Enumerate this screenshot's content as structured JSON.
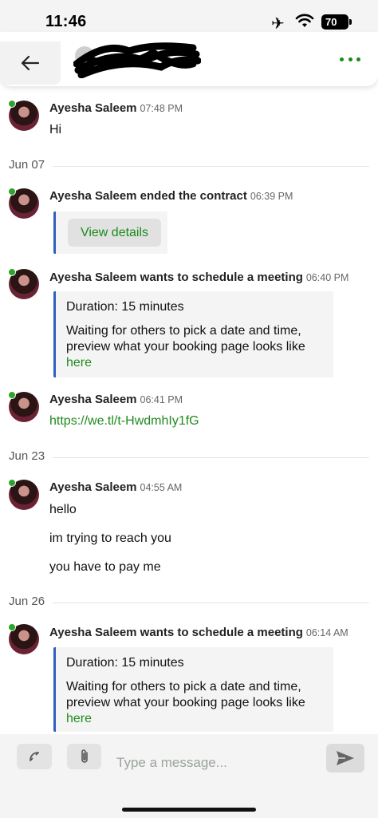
{
  "status_bar": {
    "time": "11:46",
    "battery": "70"
  },
  "header": {
    "contact_name": ""
  },
  "messages": [
    {
      "sender": "Ayesha Saleem",
      "time": "07:48 PM",
      "lines": [
        "Hi"
      ]
    }
  ],
  "date_jun07": "Jun 07",
  "msg_contract": {
    "sender": "Ayesha Saleem ended the contract",
    "time": "06:39 PM",
    "button": "View details"
  },
  "msg_meeting1": {
    "sender": "Ayesha Saleem wants to schedule a meeting",
    "time": "06:40 PM",
    "duration": "Duration: 15 minutes",
    "line1": "Waiting for others to pick a date and time,",
    "line2": "preview what your booking page looks like",
    "link": "here"
  },
  "msg_link": {
    "sender": "Ayesha Saleem",
    "time": "06:41 PM",
    "link": "https://we.tl/t-HwdmhIy1fG"
  },
  "date_jun23": "Jun 23",
  "msg_hello": {
    "sender": "Ayesha Saleem",
    "time": "04:55 AM",
    "lines": [
      "hello",
      "im trying to reach you",
      "you have to pay me"
    ]
  },
  "date_jun26": "Jun 26",
  "msg_meeting2": {
    "sender": "Ayesha Saleem wants to schedule a meeting",
    "time": "06:14 AM",
    "duration": "Duration: 15 minutes",
    "line1": "Waiting for others to pick a date and time,",
    "line2": "preview what your booking page looks like",
    "link": "here"
  },
  "composer": {
    "placeholder": "Type a message..."
  },
  "colors": {
    "accent_green": "#1f8b1f",
    "online_dot": "#2ca52c",
    "card_border": "#2e5fbf"
  },
  "icons": [
    "airplane-icon",
    "wifi-icon",
    "battery-icon",
    "back-arrow-icon",
    "more-dots-icon",
    "phone-icon",
    "paperclip-icon",
    "send-icon"
  ]
}
